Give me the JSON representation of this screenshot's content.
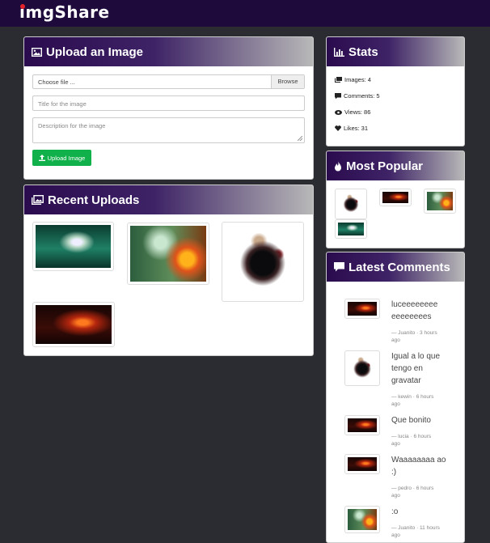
{
  "app": {
    "brand": "imgShare"
  },
  "upload": {
    "title": "Upload an Image",
    "file_placeholder": "Choose file ...",
    "browse_label": "Browse",
    "title_placeholder": "Title for the image",
    "description_placeholder": "Description for the image",
    "submit_label": "Upload Image"
  },
  "recent": {
    "title": "Recent Uploads",
    "items": [
      {
        "image": "glowing-forest-tree"
      },
      {
        "image": "deer-fire-forest"
      },
      {
        "image": "raven-splash"
      },
      {
        "image": "fire-sparks"
      }
    ]
  },
  "stats": {
    "title": "Stats",
    "images": "Images: 4",
    "comments": "Comments: 5",
    "views": "Views: 86",
    "likes": "Likes: 31"
  },
  "popular": {
    "title": "Most Popular",
    "items": [
      {
        "image": "raven-splash"
      },
      {
        "image": "fire-sparks"
      },
      {
        "image": "deer-fire-forest"
      },
      {
        "image": "glowing-forest-tree"
      }
    ]
  },
  "latest": {
    "title": "Latest Comments",
    "items": [
      {
        "text": "luceeeeeeee eeeeeeees",
        "meta": "— Juanito · 3 hours ago",
        "image": "fire-sparks"
      },
      {
        "text": "Igual a lo que tengo en gravatar",
        "meta": "— kewin · 6 hours ago",
        "image": "raven-splash"
      },
      {
        "text": "Que bonito",
        "meta": "— lucia · 6 hours ago",
        "image": "fire-sparks"
      },
      {
        "text": "Waaaaaaaa ao :)",
        "meta": "— pedro · 6 hours ago",
        "image": "fire-sparks"
      },
      {
        "text": ":o",
        "meta": "— Juanito · 11 hours ago",
        "image": "deer-fire-forest"
      }
    ]
  },
  "colors": {
    "navbar": "#1f0a3c",
    "upload_button": "#10b04a",
    "background": "#2b2c31"
  }
}
